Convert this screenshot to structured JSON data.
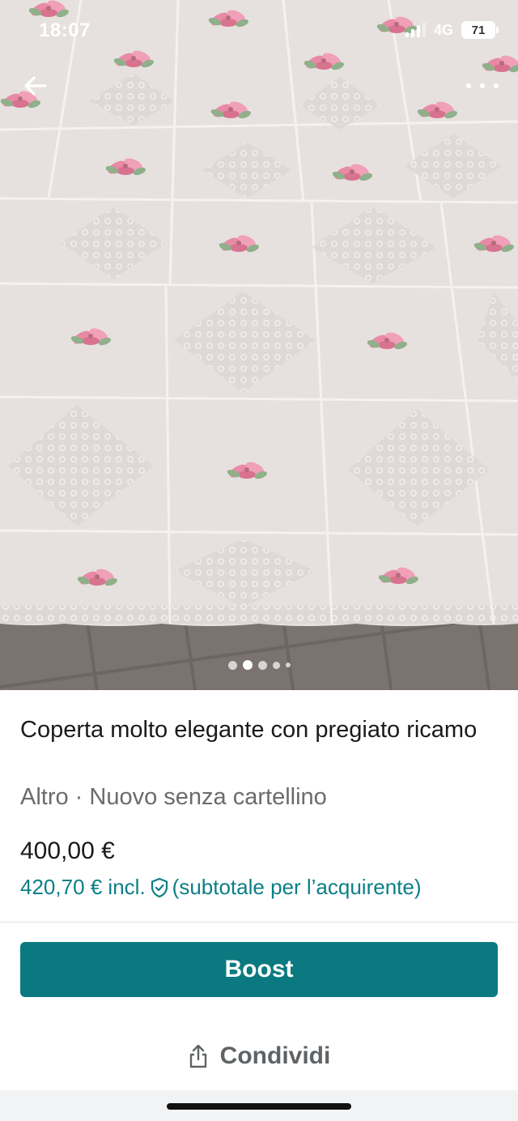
{
  "status_bar": {
    "time": "18:07",
    "network": "4G",
    "battery": "71"
  },
  "gallery": {
    "image_count": 5,
    "active_index": 1,
    "description_icon": "embroidered-bedspread-photo"
  },
  "navigation": {
    "back_icon": "arrow-left-icon",
    "more_icon": "more-horizontal-icon"
  },
  "item": {
    "title": "Coperta molto elegante con pregiato ricamo",
    "subtitle": "Altro · Nuovo senza cartellino",
    "price": "400,00 €",
    "price_incl": "420,70 € incl.",
    "price_incl_note": "(subtotale per l’acquirente)"
  },
  "actions": {
    "boost_label": "Boost",
    "share_label": "Condividi"
  },
  "colors": {
    "accent": "#0b7a80",
    "accent_text": "#0b7f86",
    "secondary_text": "#6b6b6b"
  }
}
